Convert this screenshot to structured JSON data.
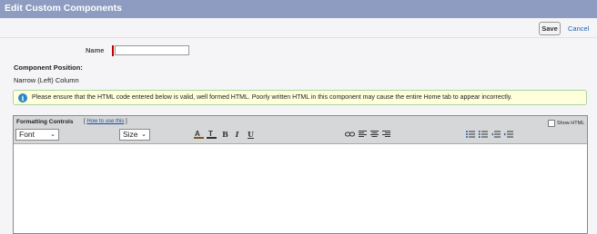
{
  "header": {
    "title": "Edit Custom Components"
  },
  "buttons": {
    "save_label": "Save",
    "cancel_label": "Cancel"
  },
  "form": {
    "name_label": "Name",
    "name_value": "",
    "position_label": "Component Position:",
    "position_value": "Narrow (Left) Column"
  },
  "notice": {
    "text": "Please ensure that the HTML code entered below is valid, well formed HTML. Poorly written HTML in this component may cause the entire Home tab to appear incorrectly."
  },
  "editor": {
    "formatting_label": "Formatting Controls",
    "howto_open": "[",
    "howto_link": "How to use this",
    "howto_close": "]",
    "show_html_label": "Show HTML",
    "show_html_checked": false,
    "font_select": "Font",
    "size_select": "Size",
    "toolbar_icons": [
      "text-color-icon",
      "background-color-icon",
      "bold-icon",
      "italic-icon",
      "underline-icon",
      "link-icon",
      "align-left-icon",
      "align-center-icon",
      "align-right-icon",
      "bullet-list-icon",
      "numbered-list-icon",
      "outdent-icon",
      "indent-icon"
    ]
  },
  "colors": {
    "header_bg": "#8d9cc0",
    "link": "#1a63b5",
    "required": "#c00000",
    "notice_bg": "#ffffdc",
    "info_icon": "#2a86c7"
  }
}
